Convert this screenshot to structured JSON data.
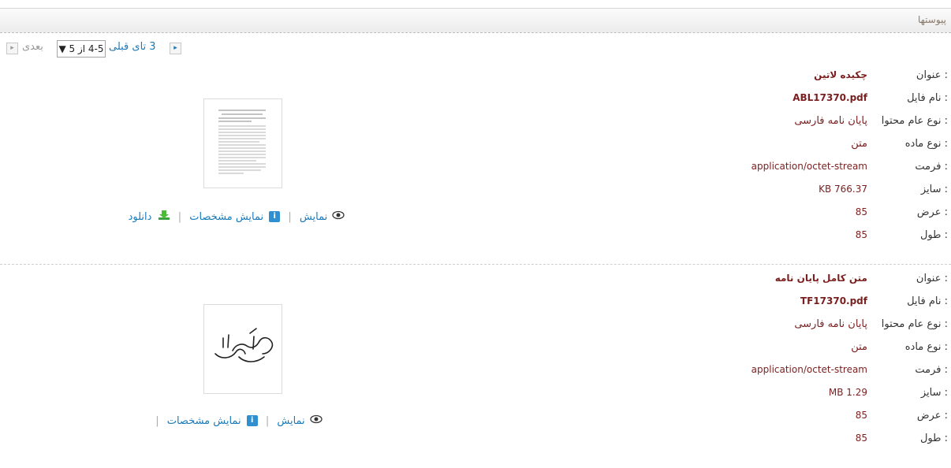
{
  "header": {
    "title": "پیوستها"
  },
  "pager": {
    "next_label": "بعدی",
    "select_value": "4-5 از 5 ▼",
    "prev_label": "3 تای قبلی",
    "next_arrow": "▸",
    "prev_arrow": "▸"
  },
  "labels": {
    "title": "عنوان :",
    "file_name": "نام فایل :",
    "content_type": "نوع عام محتوا :",
    "material_type": "نوع ماده :",
    "format": "فرمت :",
    "size": "سایز :",
    "width": "عرض :",
    "height": "طول :"
  },
  "actions": {
    "view": "نمایش",
    "details": "نمایش مشخصات",
    "download": "دانلود",
    "separator": "|",
    "info_glyph": "i"
  },
  "records": [
    {
      "title": "چکیده لاتین",
      "file_name": "ABL17370.pdf",
      "content_type": "پایان نامه فارسی",
      "material_type": "متن",
      "format": "application/octet-stream",
      "size": "KB 766.37",
      "width": "85",
      "height": "85",
      "thumbnail_icon": "document-page-thumbnail",
      "has_download": true
    },
    {
      "title": "متن کامل پایان نامه",
      "file_name": "TF17370.pdf",
      "content_type": "پایان نامه فارسی",
      "material_type": "متن",
      "format": "application/octet-stream",
      "size": "MB 1.29",
      "width": "85",
      "height": "85",
      "thumbnail_icon": "calligraphy-bismillah-thumbnail",
      "has_download": false
    }
  ]
}
